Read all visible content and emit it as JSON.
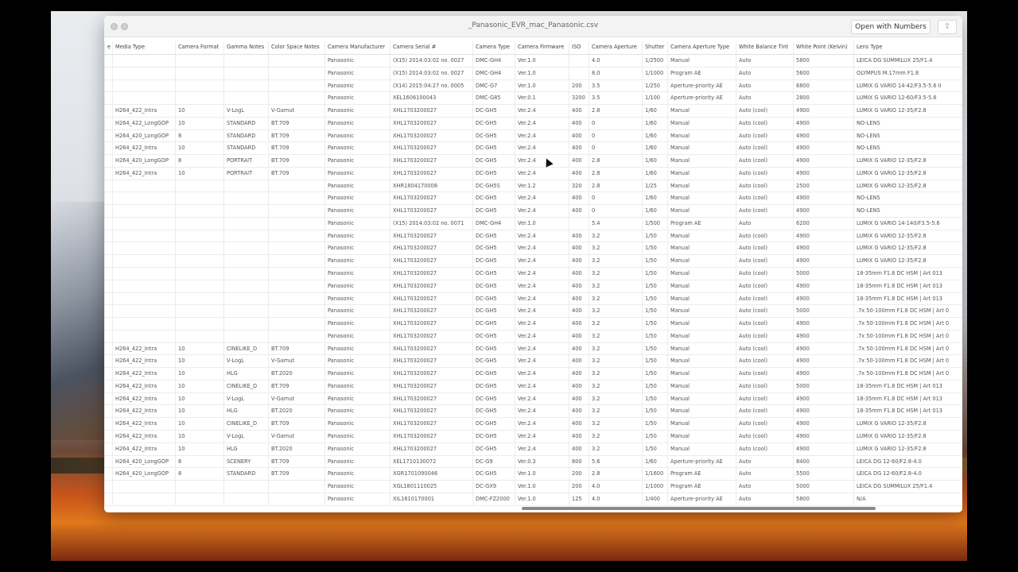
{
  "window": {
    "title": "_Panasonic_EVR_mac_Panasonic.csv",
    "open_button": "Open with Numbers",
    "share_icon": "share-icon"
  },
  "columns": [
    "e",
    "Media Type",
    "Camera Format",
    "Gamma Notes",
    "Color Space Notes",
    "Camera Manufacturer",
    "Camera Serial #",
    "Camera Type",
    "Camera Firmware",
    "ISO",
    "Camera Aperture",
    "Shutter",
    "Camera Aperture Type",
    "White Balance Tint",
    "White Point (Kelvin)",
    "Lens Type"
  ],
  "rows": [
    [
      "",
      "",
      "",
      "",
      "",
      "Panasonic",
      "(X15) 2014:03:02 no. 0027",
      "DMC-GH4",
      "Ver.1.0",
      "",
      "4.0",
      "1/2500",
      "Manual",
      "Auto",
      "5800",
      "LEICA DG SUMMILUX 25/F1.4"
    ],
    [
      "",
      "",
      "",
      "",
      "",
      "Panasonic",
      "(X15) 2014:03:02 no. 0027",
      "DMC-GH4",
      "Ver.1.0",
      "",
      "8.0",
      "1/1000",
      "Program AE",
      "Auto",
      "5600",
      "OLYMPUS M.17mm F1.8"
    ],
    [
      "",
      "",
      "",
      "",
      "",
      "Panasonic",
      "(X14) 2015:04:27 no. 0005",
      "DMC-G7",
      "Ver.1.0",
      "200",
      "3.5",
      "1/250",
      "Aperture-priority AE",
      "Auto",
      "6800",
      "LUMIX G VARIO 14-42/F3.5-5.6 II"
    ],
    [
      "",
      "",
      "",
      "",
      "",
      "Panasonic",
      "XEL1606100043",
      "DMC-G85",
      "Ver.0.1",
      "3200",
      "3.5",
      "1/100",
      "Aperture-priority AE",
      "Auto",
      "2800",
      "LUMIX G VARIO 12-60/F3.5-5.6"
    ],
    [
      "",
      "H264_422_Intra",
      "10",
      "V-LogL",
      "V-Gamut",
      "Panasonic",
      "XHL1703200027",
      "DC-GH5",
      "Ver.2.4",
      "400",
      "2.8",
      "1/60",
      "Manual",
      "Auto (cool)",
      "4900",
      "LUMIX G VARIO 12-35/F2.8"
    ],
    [
      "",
      "H264_422_LongGOP",
      "10",
      "STANDARD",
      "BT.709",
      "Panasonic",
      "XHL1703200027",
      "DC-GH5",
      "Ver.2.4",
      "400",
      "0",
      "1/60",
      "Manual",
      "Auto (cool)",
      "4900",
      "NO-LENS"
    ],
    [
      "",
      "H264_420_LongGOP",
      "8",
      "STANDARD",
      "BT.709",
      "Panasonic",
      "XHL1703200027",
      "DC-GH5",
      "Ver.2.4",
      "400",
      "0",
      "1/60",
      "Manual",
      "Auto (cool)",
      "4900",
      "NO-LENS"
    ],
    [
      "",
      "H264_422_Intra",
      "10",
      "STANDARD",
      "BT.709",
      "Panasonic",
      "XHL1703200027",
      "DC-GH5",
      "Ver.2.4",
      "400",
      "0",
      "1/60",
      "Manual",
      "Auto (cool)",
      "4900",
      "NO-LENS"
    ],
    [
      "",
      "H264_420_LongGOP",
      "8",
      "PORTRAIT",
      "BT.709",
      "Panasonic",
      "XHL1703200027",
      "DC-GH5",
      "Ver.2.4",
      "400",
      "2.8",
      "1/60",
      "Manual",
      "Auto (cool)",
      "4900",
      "LUMIX G VARIO 12-35/F2.8"
    ],
    [
      "",
      "H264_422_Intra",
      "10",
      "PORTRAIT",
      "BT.709",
      "Panasonic",
      "XHL1703200027",
      "DC-GH5",
      "Ver.2.4",
      "400",
      "2.8",
      "1/60",
      "Manual",
      "Auto (cool)",
      "4900",
      "LUMIX G VARIO 12-35/F2.8"
    ],
    [
      "",
      "",
      "",
      "",
      "",
      "Panasonic",
      "XHR1804170008",
      "DC-GH5S",
      "Ver.1.2",
      "320",
      "2.8",
      "1/25",
      "Manual",
      "Auto (cool)",
      "2500",
      "LUMIX G VARIO 12-35/F2.8"
    ],
    [
      "",
      "",
      "",
      "",
      "",
      "Panasonic",
      "XHL1703200027",
      "DC-GH5",
      "Ver.2.4",
      "400",
      "0",
      "1/60",
      "Manual",
      "Auto (cool)",
      "4900",
      "NO-LENS"
    ],
    [
      "",
      "",
      "",
      "",
      "",
      "Panasonic",
      "XHL1703200027",
      "DC-GH5",
      "Ver.2.4",
      "400",
      "0",
      "1/60",
      "Manual",
      "Auto (cool)",
      "4900",
      "NO-LENS"
    ],
    [
      "",
      "",
      "",
      "",
      "",
      "Panasonic",
      "(X15) 2014:03:02 no. 0071",
      "DMC-GH4",
      "Ver.1.0",
      "",
      "5.4",
      "1/500",
      "Program AE",
      "Auto",
      "6200",
      "LUMIX G VARIO 14-140/F3.5-5.6"
    ],
    [
      "",
      "",
      "",
      "",
      "",
      "Panasonic",
      "XHL1703200027",
      "DC-GH5",
      "Ver.2.4",
      "400",
      "3.2",
      "1/50",
      "Manual",
      "Auto (cool)",
      "4900",
      "LUMIX G VARIO 12-35/F2.8"
    ],
    [
      "",
      "",
      "",
      "",
      "",
      "Panasonic",
      "XHL1703200027",
      "DC-GH5",
      "Ver.2.4",
      "400",
      "3.2",
      "1/50",
      "Manual",
      "Auto (cool)",
      "4900",
      "LUMIX G VARIO 12-35/F2.8"
    ],
    [
      "",
      "",
      "",
      "",
      "",
      "Panasonic",
      "XHL1703200027",
      "DC-GH5",
      "Ver.2.4",
      "400",
      "3.2",
      "1/50",
      "Manual",
      "Auto (cool)",
      "4900",
      "LUMIX G VARIO 12-35/F2.8"
    ],
    [
      "",
      "",
      "",
      "",
      "",
      "Panasonic",
      "XHL1703200027",
      "DC-GH5",
      "Ver.2.4",
      "400",
      "3.2",
      "1/50",
      "Manual",
      "Auto (cool)",
      "5000",
      "18-35mm F1.8 DC HSM | Art 013"
    ],
    [
      "",
      "",
      "",
      "",
      "",
      "Panasonic",
      "XHL1703200027",
      "DC-GH5",
      "Ver.2.4",
      "400",
      "3.2",
      "1/50",
      "Manual",
      "Auto (cool)",
      "4900",
      "18-35mm F1.8 DC HSM | Art 013"
    ],
    [
      "",
      "",
      "",
      "",
      "",
      "Panasonic",
      "XHL1703200027",
      "DC-GH5",
      "Ver.2.4",
      "400",
      "3.2",
      "1/50",
      "Manual",
      "Auto (cool)",
      "4900",
      "18-35mm F1.8 DC HSM | Art 013"
    ],
    [
      "",
      "",
      "",
      "",
      "",
      "Panasonic",
      "XHL1703200027",
      "DC-GH5",
      "Ver.2.4",
      "400",
      "3.2",
      "1/50",
      "Manual",
      "Auto (cool)",
      "5000",
      ".7x 50-100mm F1.8 DC HSM | Art 0"
    ],
    [
      "",
      "",
      "",
      "",
      "",
      "Panasonic",
      "XHL1703200027",
      "DC-GH5",
      "Ver.2.4",
      "400",
      "3.2",
      "1/50",
      "Manual",
      "Auto (cool)",
      "4900",
      ".7x 50-100mm F1.8 DC HSM | Art 0"
    ],
    [
      "",
      "",
      "",
      "",
      "",
      "Panasonic",
      "XHL1703200027",
      "DC-GH5",
      "Ver.2.4",
      "400",
      "3.2",
      "1/50",
      "Manual",
      "Auto (cool)",
      "4900",
      ".7x 50-100mm F1.8 DC HSM | Art 0"
    ],
    [
      "",
      "H264_422_Intra",
      "10",
      "CINELIKE_D",
      "BT.709",
      "Panasonic",
      "XHL1703200027",
      "DC-GH5",
      "Ver.2.4",
      "400",
      "3.2",
      "1/50",
      "Manual",
      "Auto (cool)",
      "4900",
      ".7x 50-100mm F1.8 DC HSM | Art 0"
    ],
    [
      "",
      "H264_422_Intra",
      "10",
      "V-LogL",
      "V-Gamut",
      "Panasonic",
      "XHL1703200027",
      "DC-GH5",
      "Ver.2.4",
      "400",
      "3.2",
      "1/50",
      "Manual",
      "Auto (cool)",
      "4900",
      ".7x 50-100mm F1.8 DC HSM | Art 0"
    ],
    [
      "",
      "H264_422_Intra",
      "10",
      "HLG",
      "BT.2020",
      "Panasonic",
      "XHL1703200027",
      "DC-GH5",
      "Ver.2.4",
      "400",
      "3.2",
      "1/50",
      "Manual",
      "Auto (cool)",
      "4900",
      ".7x 50-100mm F1.8 DC HSM | Art 0"
    ],
    [
      "",
      "H264_422_Intra",
      "10",
      "CINELIKE_D",
      "BT.709",
      "Panasonic",
      "XHL1703200027",
      "DC-GH5",
      "Ver.2.4",
      "400",
      "3.2",
      "1/50",
      "Manual",
      "Auto (cool)",
      "5000",
      "18-35mm F1.8 DC HSM | Art 013"
    ],
    [
      "",
      "H264_422_Intra",
      "10",
      "V-LogL",
      "V-Gamut",
      "Panasonic",
      "XHL1703200027",
      "DC-GH5",
      "Ver.2.4",
      "400",
      "3.2",
      "1/50",
      "Manual",
      "Auto (cool)",
      "4900",
      "18-35mm F1.8 DC HSM | Art 013"
    ],
    [
      "",
      "H264_422_Intra",
      "10",
      "HLG",
      "BT.2020",
      "Panasonic",
      "XHL1703200027",
      "DC-GH5",
      "Ver.2.4",
      "400",
      "3.2",
      "1/50",
      "Manual",
      "Auto (cool)",
      "4900",
      "18-35mm F1.8 DC HSM | Art 013"
    ],
    [
      "",
      "H264_422_Intra",
      "10",
      "CINELIKE_D",
      "BT.709",
      "Panasonic",
      "XHL1703200027",
      "DC-GH5",
      "Ver.2.4",
      "400",
      "3.2",
      "1/50",
      "Manual",
      "Auto (cool)",
      "4900",
      "LUMIX G VARIO 12-35/F2.8"
    ],
    [
      "",
      "H264_422_Intra",
      "10",
      "V-LogL",
      "V-Gamut",
      "Panasonic",
      "XHL1703200027",
      "DC-GH5",
      "Ver.2.4",
      "400",
      "3.2",
      "1/50",
      "Manual",
      "Auto (cool)",
      "4900",
      "LUMIX G VARIO 12-35/F2.8"
    ],
    [
      "",
      "H264_422_Intra",
      "10",
      "HLG",
      "BT.2020",
      "Panasonic",
      "XHL1703200027",
      "DC-GH5",
      "Ver.2.4",
      "400",
      "3.2",
      "1/50",
      "Manual",
      "Auto (cool)",
      "4900",
      "LUMIX G VARIO 12-35/F2.8"
    ],
    [
      "",
      "H264_420_LongGOP",
      "8",
      "SCENERY",
      "BT.709",
      "Panasonic",
      "XEL1710130072",
      "DC-G9",
      "Ver.0.3",
      "800",
      "5.6",
      "1/60",
      "Aperture-priority AE",
      "Auto",
      "8400",
      "LEICA DG 12-60/F2.8-4.0"
    ],
    [
      "",
      "H264_420_LongGOP",
      "8",
      "STANDARD",
      "BT.709",
      "Panasonic",
      "XGR1701090046",
      "DC-GH5",
      "Ver.1.0",
      "200",
      "2.8",
      "1/1600",
      "Program AE",
      "Auto",
      "5500",
      "LEICA DG 12-60/F2.8-4.0"
    ],
    [
      "",
      "",
      "",
      "",
      "",
      "Panasonic",
      "XGL1801110025",
      "DC-GX9",
      "Ver.1.0",
      "200",
      "4.0",
      "1/1000",
      "Program AE",
      "Auto",
      "5000",
      "LEICA DG SUMMILUX 25/F1.4"
    ],
    [
      "",
      "",
      "",
      "",
      "",
      "Panasonic",
      "XIL1610170001",
      "DMC-FZ2000",
      "Ver.1.0",
      "125",
      "4.0",
      "1/400",
      "Aperture-priority AE",
      "Auto",
      "5800",
      "N/A"
    ]
  ]
}
